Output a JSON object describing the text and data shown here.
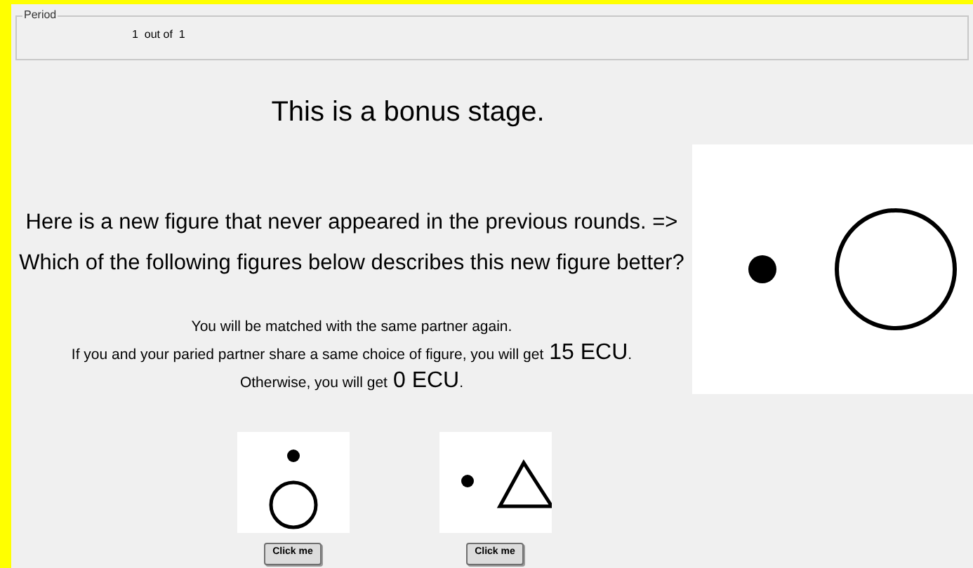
{
  "period": {
    "legend": "Period",
    "value": "1  out of  1"
  },
  "title": "This is a bonus stage.",
  "question": [
    "Here is a new figure that never appeared in the previous rounds. =>",
    "Which of the following figures below describes this new figure better?"
  ],
  "new_figure": {
    "kind": "dot-circle-side"
  },
  "info": [
    {
      "before": "You will be matched with the same partner again."
    },
    {
      "before": "If you and your paried partner share a same choice of figure, you will get",
      "amount": "15 ECU",
      "after": "."
    },
    {
      "before": "Otherwise, you will get",
      "amount": "0 ECU",
      "after": "."
    }
  ],
  "options": [
    {
      "kind": "dot-circle-above",
      "button": "Click me"
    },
    {
      "kind": "dot-triangle-side",
      "button": "Click me"
    }
  ]
}
